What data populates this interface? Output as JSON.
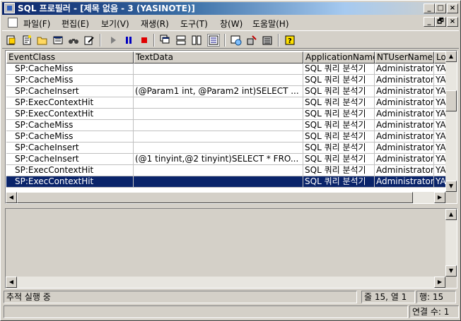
{
  "title": "SQL 프로필러 - [제목 없음 - 3 (YASINOTE)]",
  "title_buttons": [
    "_",
    "□",
    "×"
  ],
  "menu": {
    "items": [
      "파일(F)",
      "편집(E)",
      "보기(V)",
      "재생(R)",
      "도구(T)",
      "창(W)",
      "도움말(H)"
    ],
    "mdi_buttons": [
      "_",
      "🗗",
      "×"
    ]
  },
  "toolbar": {
    "icons": [
      "new-trace-icon",
      "new-template-icon",
      "open-icon",
      "properties-icon",
      "find-icon",
      "edit-icon",
      "run-icon",
      "pause-icon",
      "stop-icon",
      "cascade-icon",
      "tile-horizontal-icon",
      "tile-vertical-icon",
      "grouped-view-icon",
      "query-analyzer-icon",
      "tuning-wizard-icon",
      "report-icon",
      "help-icon"
    ],
    "colors": {
      "pause": "#0000c0",
      "stop": "#e00000",
      "run": "#808080"
    }
  },
  "grid": {
    "headers": [
      "EventClass",
      "TextData",
      "ApplicationName",
      "NTUserName",
      "Lo"
    ],
    "rows": [
      [
        "SP:CacheMiss",
        "",
        "SQL 쿼리 분석기",
        "Administrator",
        "YA"
      ],
      [
        "SP:CacheMiss",
        "",
        "SQL 쿼리 분석기",
        "Administrator",
        "YA"
      ],
      [
        "SP:CacheInsert",
        "(@Param1 int, @Param2 int)SELECT ...",
        "SQL 쿼리 분석기",
        "Administrator",
        "YA"
      ],
      [
        "SP:ExecContextHit",
        "",
        "SQL 쿼리 분석기",
        "Administrator",
        "YA"
      ],
      [
        "SP:ExecContextHit",
        "",
        "SQL 쿼리 분석기",
        "Administrator",
        "YA"
      ],
      [
        "SP:CacheMiss",
        "",
        "SQL 쿼리 분석기",
        "Administrator",
        "YA"
      ],
      [
        "SP:CacheMiss",
        "",
        "SQL 쿼리 분석기",
        "Administrator",
        "YA"
      ],
      [
        "SP:CacheInsert",
        "",
        "SQL 쿼리 분석기",
        "Administrator",
        "YA"
      ],
      [
        "SP:CacheInsert",
        "(@1 tinyint,@2 tinyint)SELECT * FRO...",
        "SQL 쿼리 분석기",
        "Administrator",
        "YA"
      ],
      [
        "SP:ExecContextHit",
        "",
        "SQL 쿼리 분석기",
        "Administrator",
        "YA"
      ],
      [
        "SP:ExecContextHit",
        "",
        "SQL 쿼리 분석기",
        "Administrator",
        "YA"
      ]
    ],
    "selected_row": 10
  },
  "status": {
    "message": "추적 실행 중",
    "position": "줄 15, 열 1",
    "rows": "행: 15",
    "connections": "연결 수: 1"
  }
}
